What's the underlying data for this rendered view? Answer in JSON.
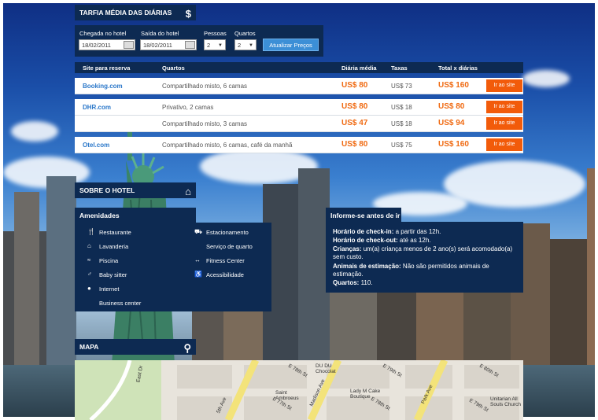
{
  "rates_title": "TARFIA MÉDIA DAS DIÁRIAS",
  "search": {
    "checkin_label": "Chegada no hotel",
    "checkin_value": "18/02/2011",
    "checkout_label": "Saída do hotel",
    "checkout_value": "18/02/2011",
    "people_label": "Pessoas",
    "people_value": "2",
    "rooms_label": "Quartos",
    "rooms_value": "2",
    "update_button": "Atualizar Preços"
  },
  "table": {
    "headers": {
      "site": "Site para reserva",
      "rooms": "Quartos",
      "avg": "Diária média",
      "taxes": "Taxas",
      "total": "Total x diárias"
    },
    "rows": [
      {
        "site": "Booking.com",
        "room": "Compartilhado misto, 6 camas",
        "avg": "US$ 80",
        "tax": "US$ 73",
        "total": "US$ 160",
        "button": "Ir ao site"
      },
      {
        "site": "DHR.com",
        "room": "Privativo, 2 camas",
        "avg": "US$ 80",
        "tax": "US$ 18",
        "total": "US$ 80",
        "button": "Ir ao site"
      },
      {
        "site": "",
        "room": "Compartilhado misto, 3 camas",
        "avg": "US$ 47",
        "tax": "US$ 18",
        "total": "US$ 94",
        "button": "Ir ao site"
      },
      {
        "site": "Otel.com",
        "room": "Compartilhado misto, 6 camas, café da manhã",
        "avg": "US$ 80",
        "tax": "US$ 75",
        "total": "US$ 160",
        "button": "Ir ao site"
      }
    ]
  },
  "hotel_title": "SOBRE O HOTEL",
  "amenities": {
    "title": "Amenidades",
    "left": [
      "Restaurante",
      "Lavanderia",
      "Piscina",
      "Baby sitter",
      "Internet",
      "Business center"
    ],
    "right": [
      "Estacionamento",
      "Serviço de quarto",
      "Fitness Center",
      "Acessibilidade"
    ]
  },
  "info": {
    "title": "Informe-se antes de ir",
    "checkin_label": "Horário de check-in:",
    "checkin_text": " a partir das 12h.",
    "checkout_label": "Horário de check-out:",
    "checkout_text": " até as 12h.",
    "children_label": "Crianças:",
    "children_text": " um(a) criança menos de 2 ano(s) será acomodado(a) sem custo.",
    "pets_label": "Animais de estimação:",
    "pets_text": " Não são permitidos animais de estimação.",
    "rooms_label": "Quartos:",
    "rooms_text": " 110."
  },
  "map": {
    "title": "MAPA",
    "streets": [
      "E 78th St",
      "E 77th St",
      "E 79th St",
      "E 78th St",
      "E 80th St",
      "E 79th St",
      "East Dr",
      "5th Ave",
      "Madison Ave",
      "Park Ave",
      "DU DU Chocolat",
      "Lady M Cake Boutique",
      "Saint Ambroeus",
      "Unitarian All Souls Church"
    ]
  },
  "colors": {
    "navy": "#0d2a52",
    "accent_orange": "#f25b0a",
    "link_blue": "#2a77c9",
    "price_orange": "#f06a12"
  }
}
